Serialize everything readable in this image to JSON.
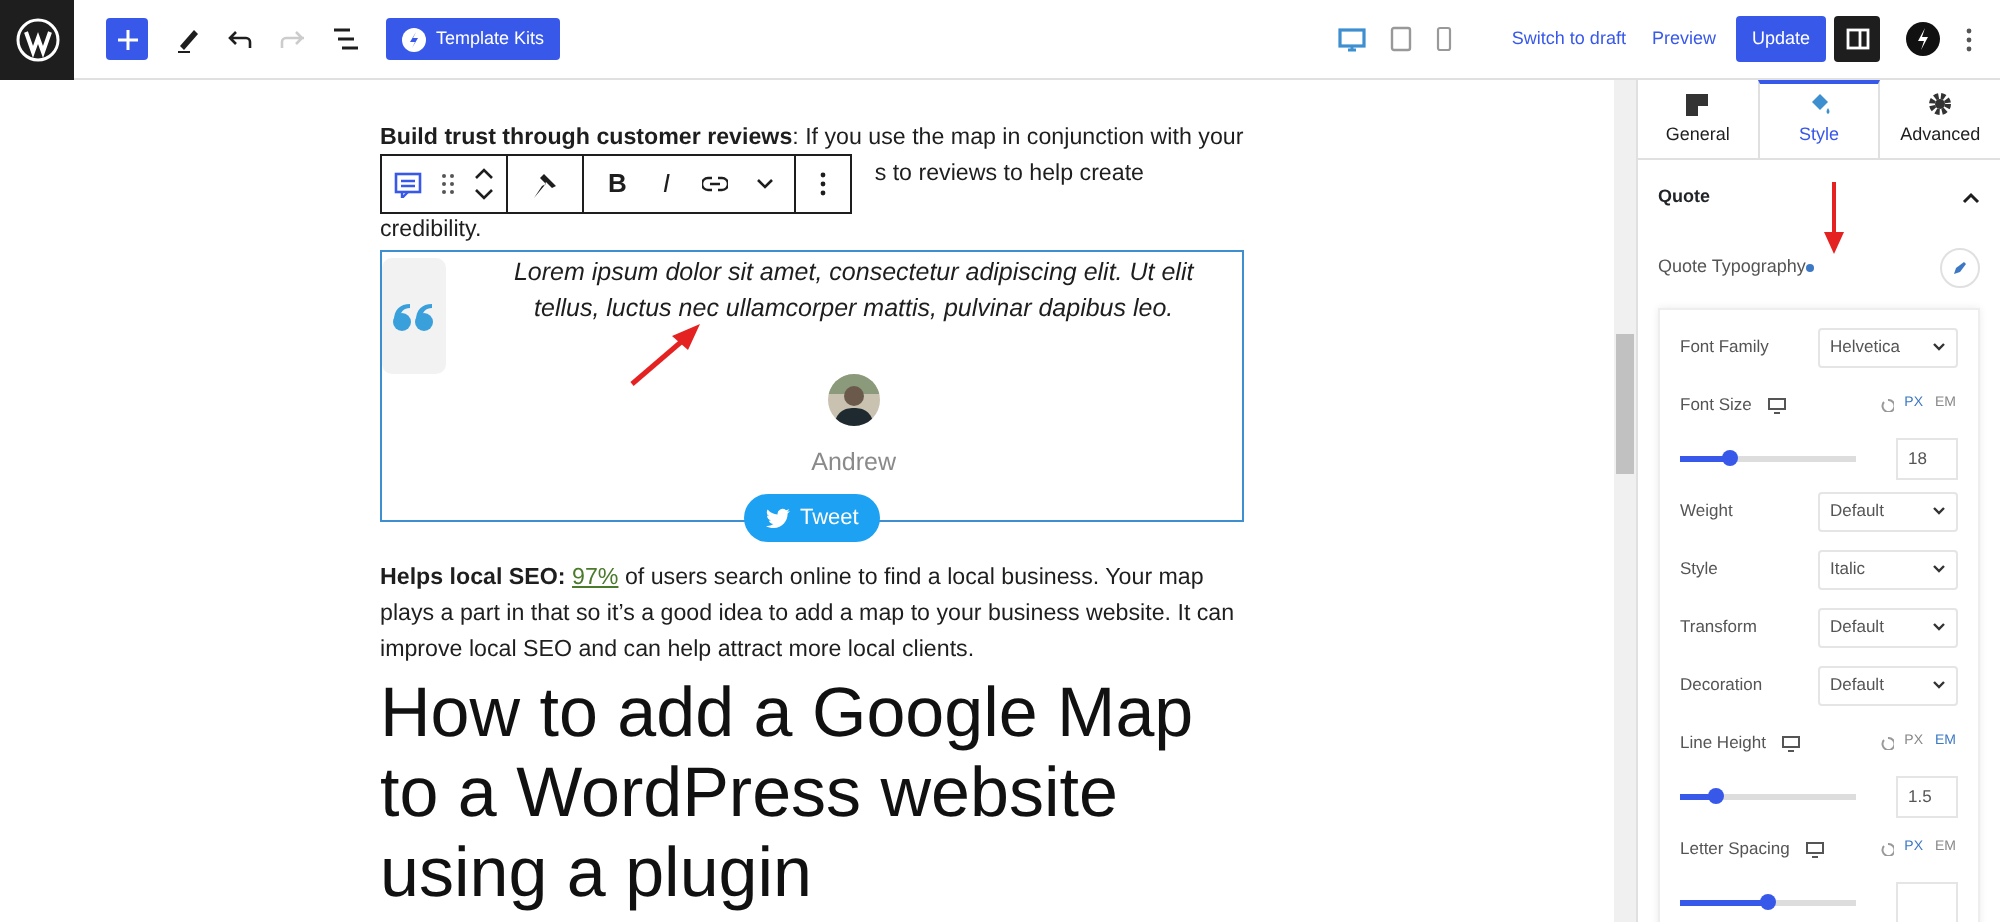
{
  "topbar": {
    "template_button": "Template Kits",
    "devices": [
      {
        "kind": "desktop",
        "selected": true
      },
      {
        "kind": "tablet",
        "selected": false
      },
      {
        "kind": "mobile",
        "selected": false
      }
    ],
    "switch_link": "Switch to draft",
    "preview_link": "Preview",
    "update_button": "Update"
  },
  "block_toolbar": {
    "format_buttons": [
      "B",
      "I"
    ]
  },
  "content": {
    "paragraph_1": {
      "line_1": "**Build trust through customer reviews**: If you use the map in conjunction with your",
      "line_2": "s to reviews to help create",
      "line_3": "credibility."
    },
    "quote": {
      "text": "Lorem ipsum dolor sit amet, consectetur adipiscing elit. Ut elit tellus, luctus nec ullamcorper mattis, pulvinar dapibus leo.",
      "author": "Andrew",
      "tweet_button": "Tweet"
    },
    "paragraph_2": {
      "lead": "Helps local SEO:",
      "link": "97%",
      "rest": " of users search online to find a local business. Your map plays a part in that so it’s a good idea to add a map to your business website. It can improve local SEO and can help attract more local clients."
    },
    "heading": "How to add a Google Map to a WordPress website using a plugin"
  },
  "sidebar": {
    "tabs": [
      {
        "label": "General",
        "kind": "general",
        "selected": false
      },
      {
        "label": "Style",
        "kind": "style",
        "selected": true
      },
      {
        "label": "Advanced",
        "kind": "advanced",
        "selected": false
      }
    ],
    "section": {
      "title": "Quote",
      "expanded": true
    },
    "typography_label": "Quote Typography",
    "fields": [
      {
        "kind": "select",
        "label": "Font Family",
        "value": "Helvetica"
      },
      {
        "kind": "slider",
        "label": "Font Size",
        "units": [
          {
            "label": "PX",
            "selected": true
          },
          {
            "label": "EM",
            "selected": false
          }
        ],
        "level": 0.28,
        "value": "18"
      },
      {
        "kind": "select",
        "label": "Weight",
        "value": "Default"
      },
      {
        "kind": "select",
        "label": "Style",
        "value": "Italic"
      },
      {
        "kind": "select",
        "label": "Transform",
        "value": "Default"
      },
      {
        "kind": "select",
        "label": "Decoration",
        "value": "Default"
      },
      {
        "kind": "slider",
        "label": "Line Height",
        "units": [
          {
            "label": "PX",
            "selected": false
          },
          {
            "label": "EM",
            "selected": true
          }
        ],
        "level": 0.2,
        "value": "1.5"
      },
      {
        "kind": "slider",
        "label": "Letter Spacing",
        "units": [
          {
            "label": "PX",
            "selected": true
          },
          {
            "label": "EM",
            "selected": false
          }
        ],
        "level": 0.5
      }
    ]
  }
}
